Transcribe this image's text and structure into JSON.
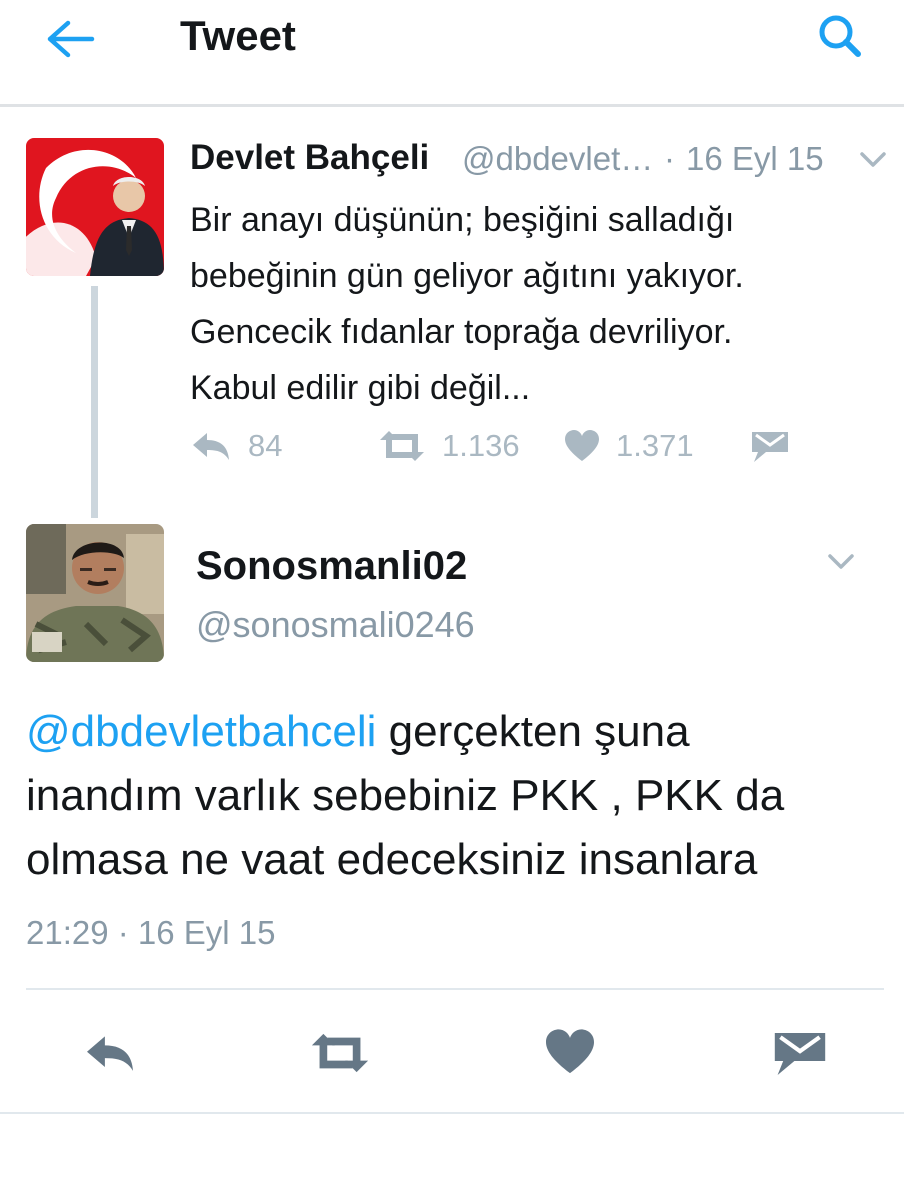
{
  "header": {
    "title": "Tweet",
    "back_icon": "arrow-left-icon",
    "search_icon": "search-icon",
    "accent": "#1da1f2"
  },
  "original_tweet": {
    "name": "Devlet Bahçeli",
    "handle": "@dbdevlet…",
    "separator": "·",
    "date": "16 Eyl 15",
    "text_lines": [
      "Bir anayı düşünün; beşiğini salladığı",
      "bebeğinin gün geliyor ağıtını yakıyor.",
      "Gencecik fıdanlar toprağa devriliyor.",
      "Kabul edilir gibi değil..."
    ],
    "stats": {
      "replies": "84",
      "retweets": "1.136",
      "likes": "1.371"
    }
  },
  "reply_tweet": {
    "name": "Sonosmanli02",
    "handle": "@sonosmali0246",
    "mention": "@dbdevletbahceli",
    "text_lines": [
      " gerçekten şuna",
      "inandım varlık sebebiniz PKK , PKK da",
      "olmasa ne vaat edeceksiniz insanlara"
    ],
    "timestamp": "21:29 · 16 Eyl 15"
  },
  "colors": {
    "accent": "#1da1f2",
    "muted_text": "#8899a6",
    "icon_gray": "#aab8c2",
    "dark_icon": "#657786"
  }
}
